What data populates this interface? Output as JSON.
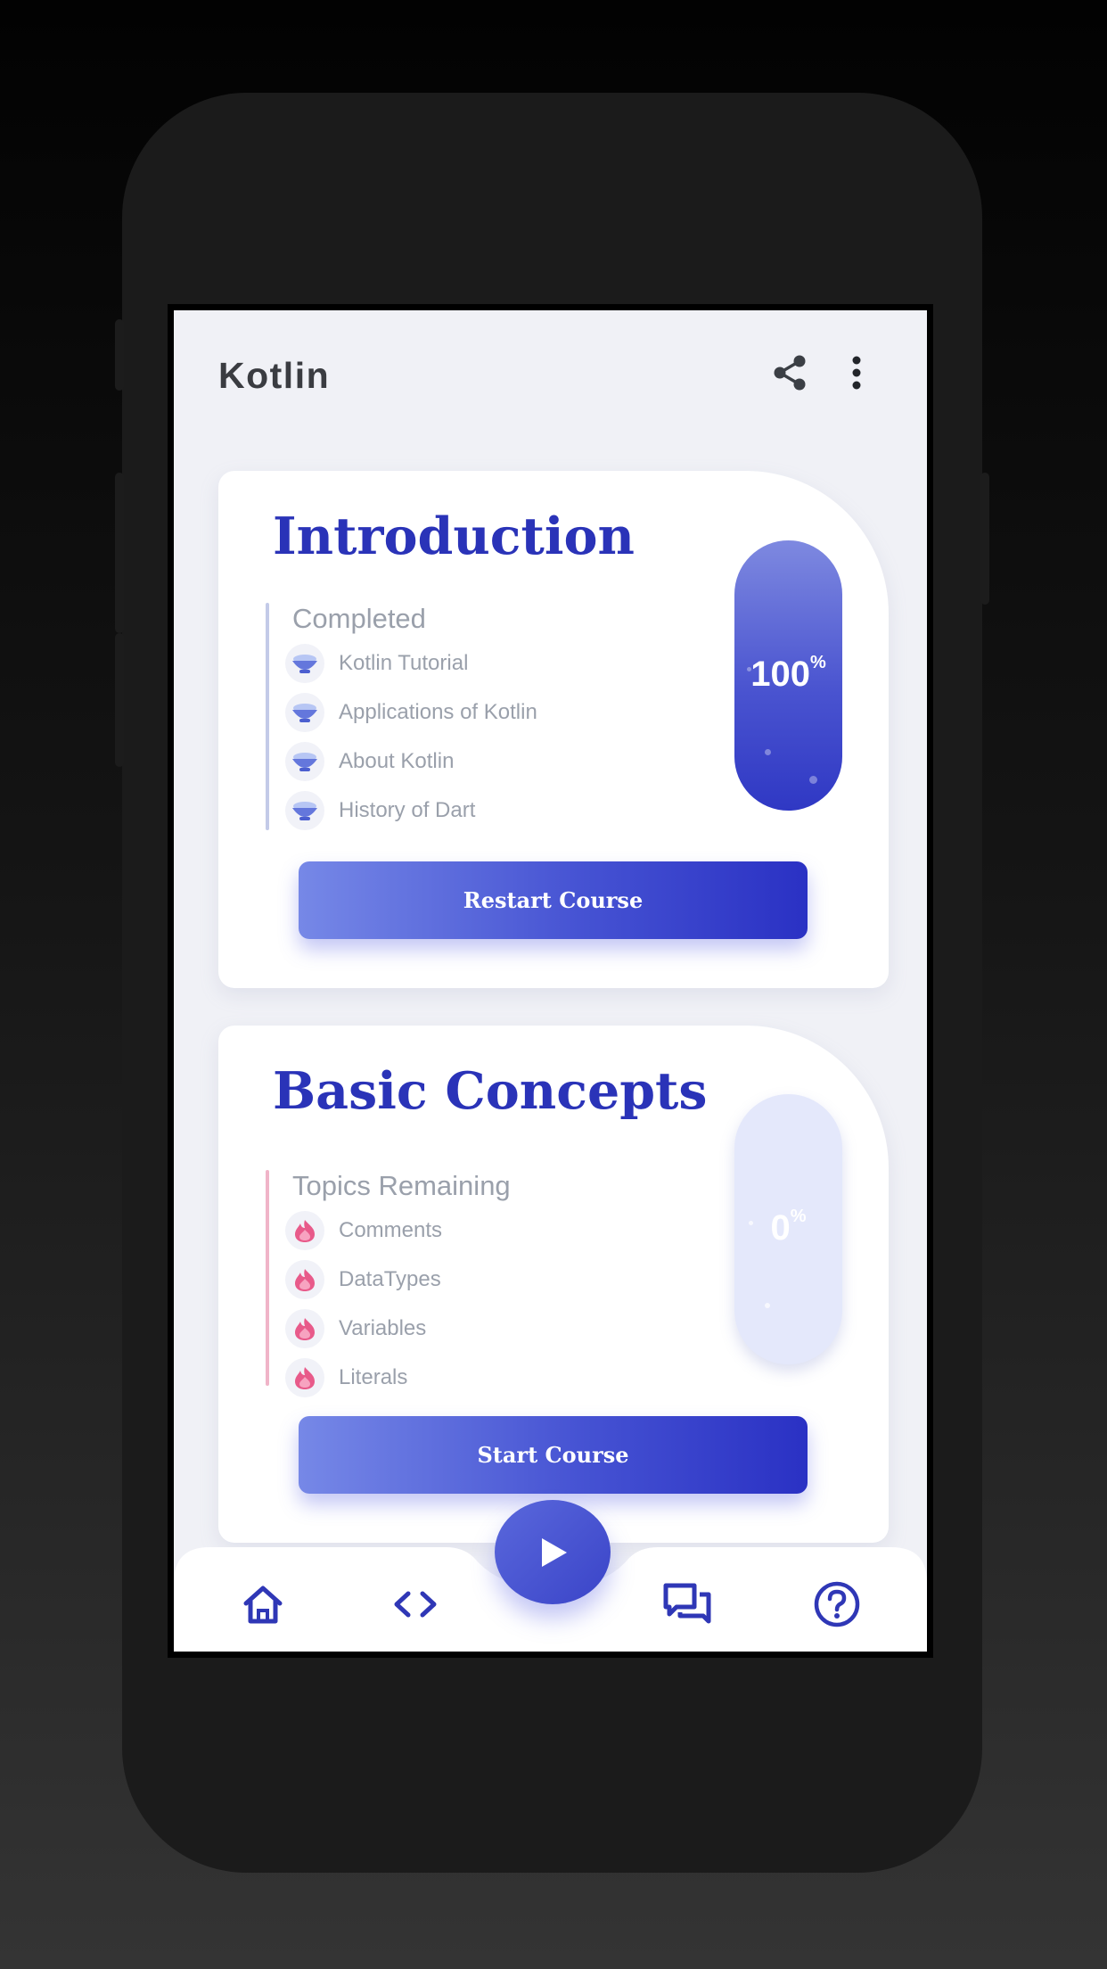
{
  "app": {
    "title": "Kotlin"
  },
  "colors": {
    "accent": "#2a33b8",
    "completed_bar": "#c3cae8",
    "remaining_bar": "#f0b4c8",
    "pill_complete": "#3d45cb",
    "pill_empty": "#e4e8fb"
  },
  "icons": {
    "share": "share-icon",
    "menu": "more-vert-icon",
    "completed_topic": "bowl-icon",
    "remaining_topic": "flame-icon",
    "home": "home-icon",
    "code": "code-icon",
    "play": "play-icon",
    "forum": "forum-icon",
    "help": "help-icon"
  },
  "courses": [
    {
      "title": "Introduction",
      "status_label": "Completed",
      "topics": [
        "Kotlin Tutorial",
        "Applications of Kotlin",
        "About Kotlin",
        "History of Dart"
      ],
      "progress_value": "100",
      "progress_unit": "%",
      "progress_fraction": 1.0,
      "button_label": "Restart Course"
    },
    {
      "title": "Basic Concepts",
      "status_label": "Topics Remaining",
      "topics": [
        "Comments",
        "DataTypes",
        "Variables",
        "Literals"
      ],
      "progress_value": "0",
      "progress_unit": "%",
      "progress_fraction": 0.0,
      "button_label": "Start Course"
    }
  ]
}
